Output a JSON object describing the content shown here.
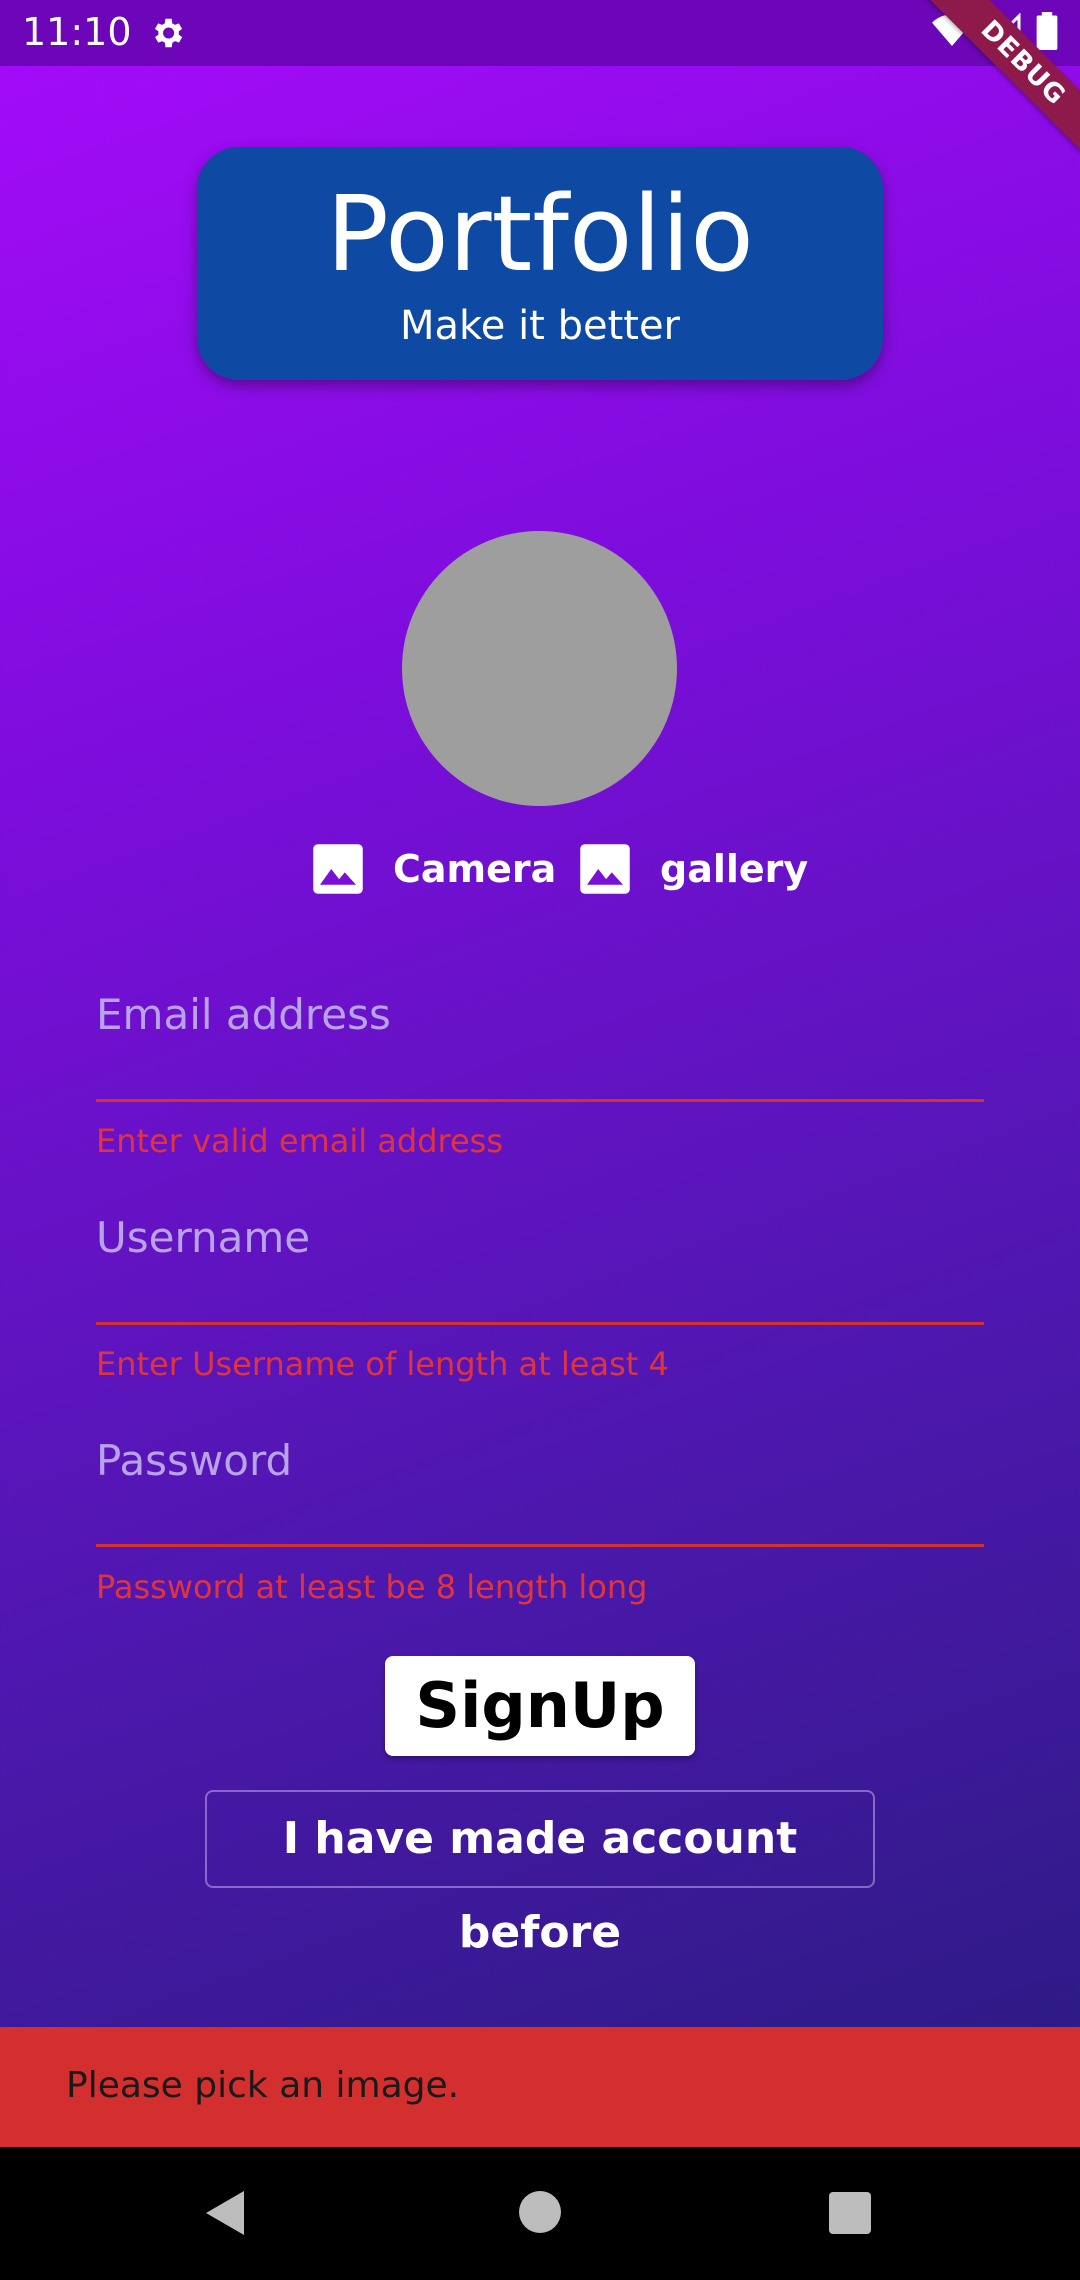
{
  "status_bar": {
    "time": "11:10",
    "debug_label": "DEBUG"
  },
  "header": {
    "title": "Portfolio",
    "subtitle": "Make it better"
  },
  "image_picker": {
    "camera_label": "Camera",
    "gallery_label": "gallery"
  },
  "form": {
    "email": {
      "placeholder": "Email address",
      "error": "Enter valid email address"
    },
    "username": {
      "placeholder": "Username",
      "error": "Enter Username of length at least 4"
    },
    "password": {
      "placeholder": "Password",
      "error": "Password at least be 8 length long"
    }
  },
  "buttons": {
    "signup": "SignUp",
    "login": "I have made account before"
  },
  "snackbar": {
    "message": "Please pick an image."
  },
  "colors": {
    "header_card": "#0e49a4",
    "error": "#e0343d",
    "snackbar": "#d32f2f"
  }
}
